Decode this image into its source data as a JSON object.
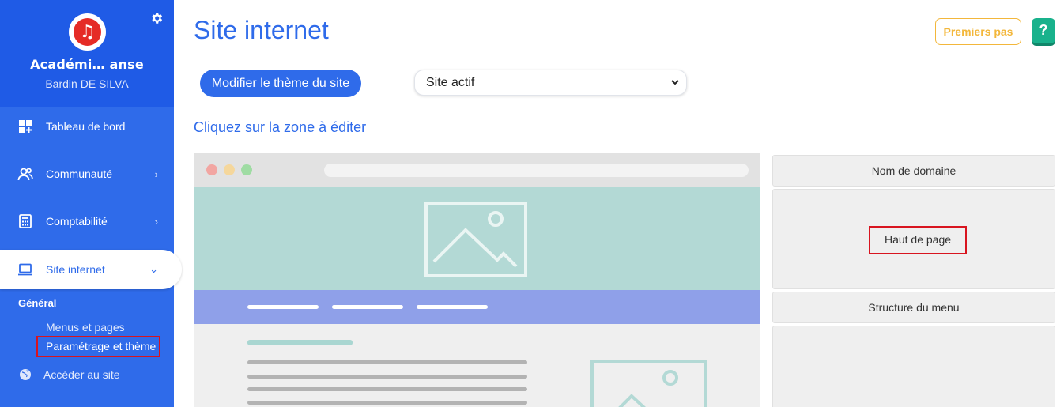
{
  "sidebar": {
    "org_name": "Académi… anse",
    "user_name": "Bardin DE SILVA",
    "items": [
      {
        "label": "Tableau de bord",
        "icon": "dashboard-icon"
      },
      {
        "label": "Communauté",
        "icon": "users-icon"
      },
      {
        "label": "Comptabilité",
        "icon": "calculator-icon"
      },
      {
        "label": "Site internet",
        "icon": "laptop-icon"
      }
    ],
    "section_title": "Général",
    "sub_items": [
      "Menus et pages",
      "Paramétrage et thème"
    ],
    "access_site": "Accéder au site",
    "colors": {
      "background": "#2f6bea",
      "header": "#1f5be6",
      "avatar": "#e52b26"
    }
  },
  "header": {
    "title": "Site internet",
    "first_steps": "Premiers pas",
    "help": "?"
  },
  "toolbar": {
    "modify_theme": "Modifier le thème du site",
    "site_select": "Site actif"
  },
  "hint": "Cliquez sur la zone à éditer",
  "zones": {
    "domain": "Nom de domaine",
    "header": "Haut de page",
    "menu": "Structure du menu"
  }
}
